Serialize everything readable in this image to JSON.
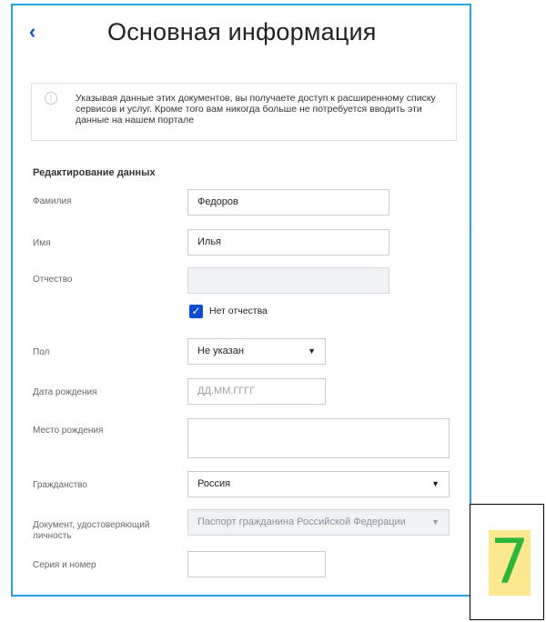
{
  "header": {
    "back_glyph": "‹",
    "title": "Основная информация"
  },
  "info": {
    "icon": "info-icon",
    "text": "Указывая данные этих документов, вы получаете доступ к расширенному списку сервисов и услуг. Кроме того вам никогда больше не потребуется вводить эти данные на нашем портале"
  },
  "section_title": "Редактирование данных",
  "form": {
    "lastname": {
      "label": "Фамилия",
      "value": "Федоров"
    },
    "firstname": {
      "label": "Имя",
      "value": "Илья"
    },
    "patronymic": {
      "label": "Отчество",
      "value": ""
    },
    "no_patronymic": {
      "label": "Нет отчества",
      "checked": true,
      "check_glyph": "✓"
    },
    "gender": {
      "label": "Пол",
      "value": "Не указан",
      "arrow": "▼"
    },
    "birthdate": {
      "label": "Дата рождения",
      "placeholder": "ДД.ММ.ГГГГ"
    },
    "birthplace": {
      "label": "Место рождения",
      "value": ""
    },
    "citizenship": {
      "label": "Гражданство",
      "value": "Россия",
      "arrow": "▼"
    },
    "document": {
      "label": "Документ, удостоверяющий личность",
      "value": "Паспорт гражданина Российской Федерации",
      "arrow": "▼"
    },
    "series_number": {
      "label": "Серия и номер",
      "value": ""
    }
  },
  "badge": {
    "number": "7"
  },
  "colors": {
    "accent": "#0d4cd3",
    "frame": "#29a0e0",
    "badge_bg": "#fce88e",
    "badge_text": "#2fb53c"
  }
}
